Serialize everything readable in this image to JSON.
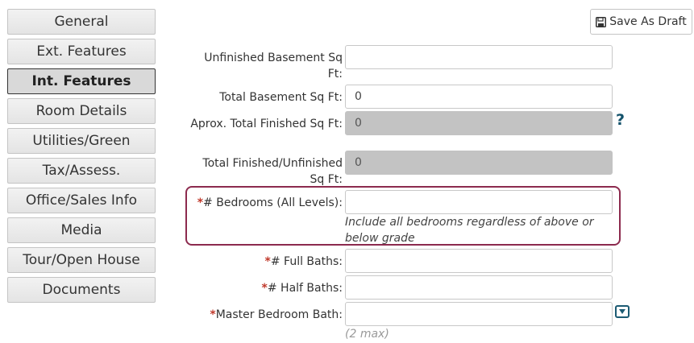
{
  "sidebar": {
    "items": [
      {
        "label": "General"
      },
      {
        "label": "Ext. Features"
      },
      {
        "label": "Int. Features"
      },
      {
        "label": "Room Details"
      },
      {
        "label": "Utilities/Green"
      },
      {
        "label": "Tax/Assess."
      },
      {
        "label": "Office/Sales Info"
      },
      {
        "label": "Media"
      },
      {
        "label": "Tour/Open House"
      },
      {
        "label": "Documents"
      }
    ]
  },
  "toolbar": {
    "save_draft_label": "Save As Draft"
  },
  "form": {
    "unfinished_basement": {
      "label": "Unfinished Basement Sq Ft:",
      "value": ""
    },
    "total_basement": {
      "label": "Total Basement Sq Ft:",
      "value": "0"
    },
    "approx_total_finished": {
      "label": "Aprox. Total Finished Sq Ft:",
      "value": "0"
    },
    "total_finished_unfinished": {
      "label": "Total Finished/Unfinished Sq Ft:",
      "value": "0"
    },
    "bedrooms": {
      "required_mark": "*",
      "label": "# Bedrooms (All Levels):",
      "value": "",
      "hint": "Include all bedrooms regardless of above or below grade"
    },
    "full_baths": {
      "required_mark": "*",
      "label": "# Full Baths:",
      "value": ""
    },
    "half_baths": {
      "required_mark": "*",
      "label": "# Half Baths:",
      "value": ""
    },
    "master_bedroom_bath": {
      "required_mark": "*",
      "label": "Master Bedroom Bath:",
      "value": "",
      "hint": "(2 max)"
    },
    "help_glyph": "?"
  },
  "colors": {
    "required": "#c0392b",
    "highlight_border": "#8c2a4e",
    "icon_accent": "#14526b",
    "disabled_field": "#c3c3c3"
  },
  "icons": [
    "save-icon",
    "help-icon",
    "dropdown-icon"
  ]
}
